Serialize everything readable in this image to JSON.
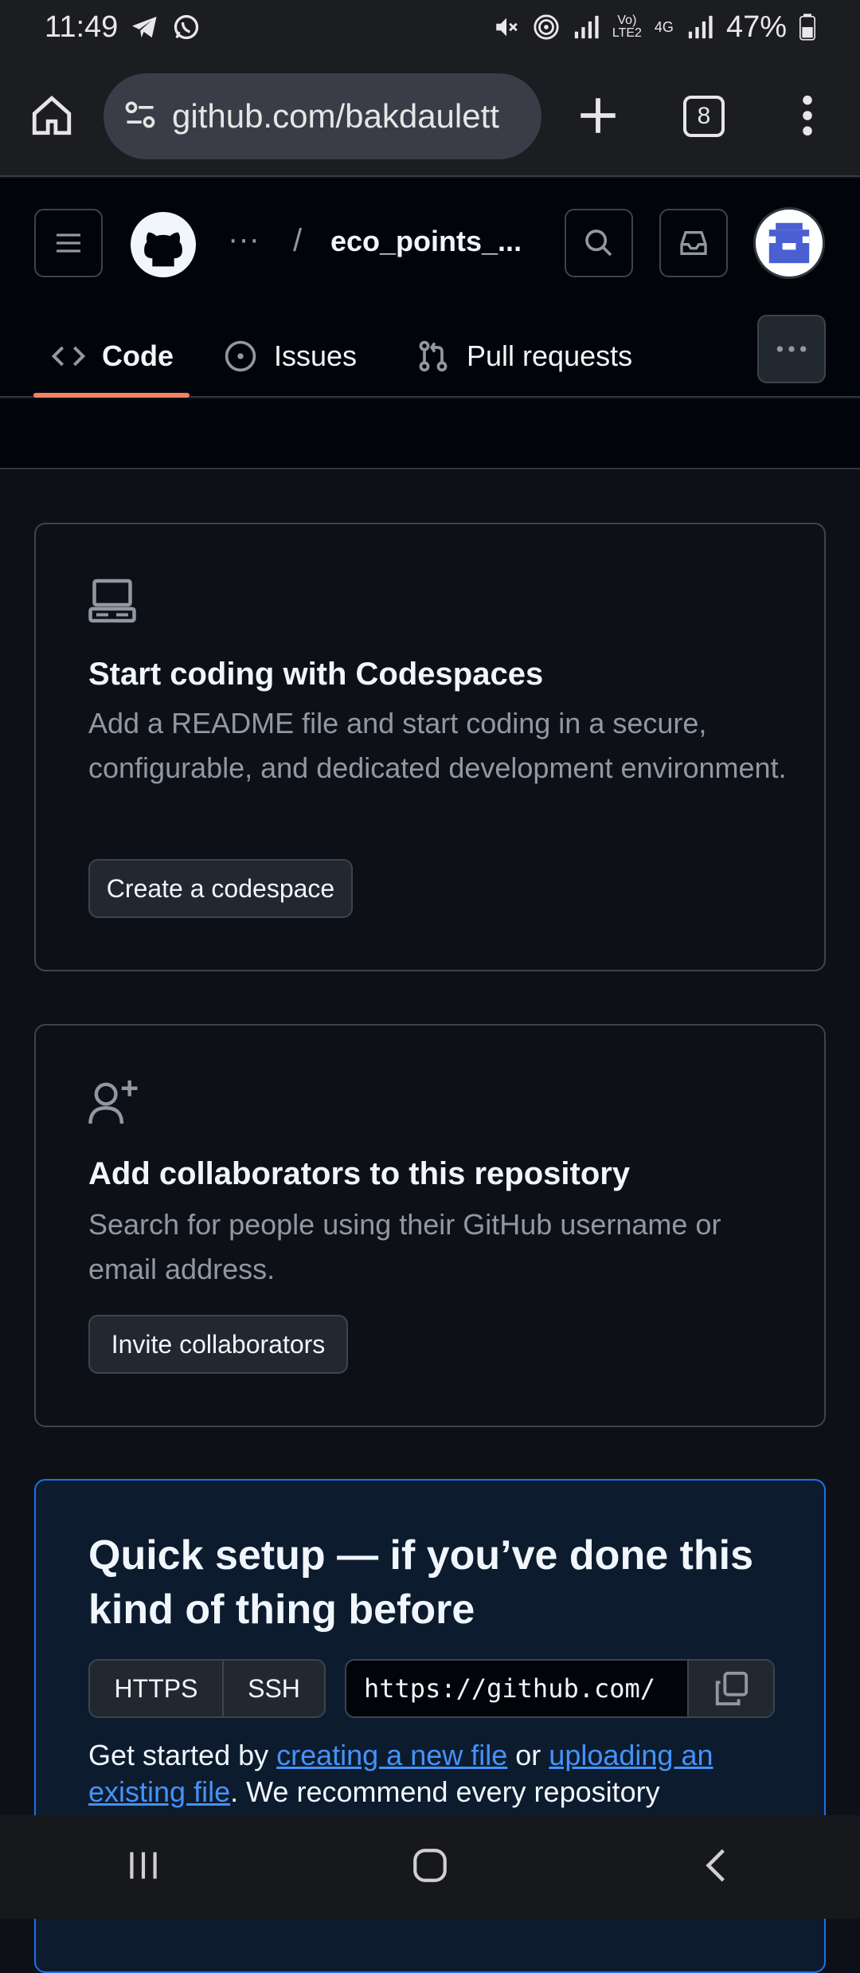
{
  "status_bar": {
    "time": "11:49",
    "battery": "47%"
  },
  "browser": {
    "url": "github.com/bakdaulett",
    "tab_count": "8"
  },
  "header": {
    "breadcrumb_dots": "···",
    "breadcrumb_sep": "/",
    "repo_name": "eco_points_..."
  },
  "tabs": [
    {
      "label": "Code",
      "active": true
    },
    {
      "label": "Issues",
      "active": false
    },
    {
      "label": "Pull requests",
      "active": false
    }
  ],
  "codespaces_card": {
    "title": "Start coding with Codespaces",
    "description": "Add a README file and start coding in a secure, configurable, and dedicated development environment.",
    "button": "Create a codespace"
  },
  "collab_card": {
    "title": "Add collaborators to this repository",
    "description": "Search for people using their GitHub username or email address.",
    "button": "Invite collaborators"
  },
  "quick_setup": {
    "title": "Quick setup — if you’ve done this kind of thing before",
    "https_label": "HTTPS",
    "ssh_label": "SSH",
    "clone_url": "https://github.com/",
    "text_before": "Get started by ",
    "link1": "creating a new file",
    "text_middle": " or ",
    "link2": "uploading an existing file",
    "text_after": ". We recommend every repository"
  },
  "colors": {
    "background": "#0d1117",
    "header": "#010409",
    "accent_tab": "#f78166",
    "link": "#4493f8",
    "quick_border": "#1f6feb"
  }
}
